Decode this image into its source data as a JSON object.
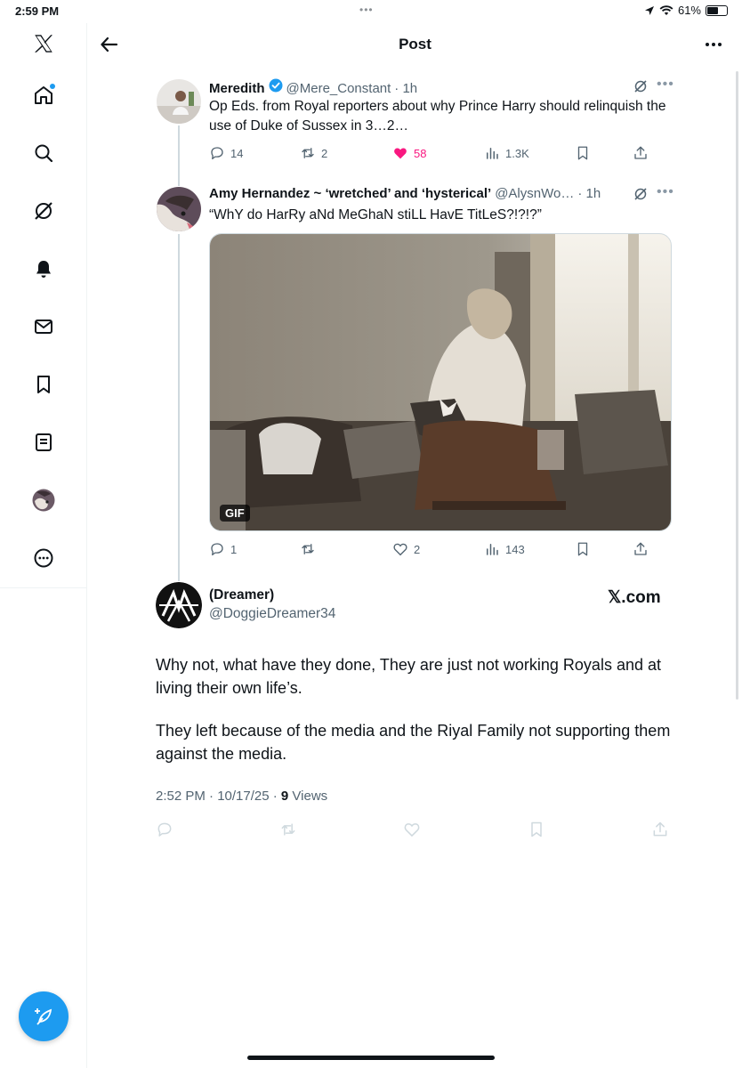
{
  "status_bar": {
    "time": "2:59 PM",
    "battery": "61%",
    "battery_level": 0.61
  },
  "header": {
    "title": "Post"
  },
  "sidebar": {
    "items": [
      "home-icon",
      "search-icon",
      "grok-icon",
      "notifications-icon",
      "messages-icon",
      "bookmarks-icon",
      "lists-icon",
      "profile-avatar",
      "more-icon"
    ],
    "compose_icon": "compose-feather-icon"
  },
  "thread": [
    {
      "name": "Meredith",
      "verified": true,
      "handle": "@Mere_Constant",
      "time": "· 1h",
      "text": "Op Eds. from Royal reporters about why Prince Harry should relinquish the use of Duke of Sussex in 3…2…",
      "replies": "14",
      "reposts": "2",
      "likes": "58",
      "liked": true,
      "views": "1.3K"
    },
    {
      "name": "Amy Hernandez ~ ‘wretched’ and ‘hysterical’",
      "handle": "@AlysnWo…",
      "time": "· 1h",
      "text": "“WhY do HarRy aNd MeGhaN stiLL HavE TitLeS?!?!?”",
      "media_badge": "GIF",
      "replies": "1",
      "reposts": "",
      "likes": "2",
      "views": "143"
    }
  ],
  "main_post": {
    "name": "(Dreamer)",
    "handle": "@DoggieDreamer34",
    "source": "𝕏.com",
    "paragraph1": "Why not, what have they done, They are just not working Royals and at living their own life’s.",
    "paragraph2": "They left because of the media and the Riyal Family not supporting them against the media.",
    "timestamp": "2:52 PM · 10/17/25 · ",
    "views_count": "9",
    "views_label": " Views"
  },
  "colors": {
    "accent": "#1d9bf0",
    "like": "#f91880",
    "text": "#0f1419",
    "muted": "#536471"
  }
}
